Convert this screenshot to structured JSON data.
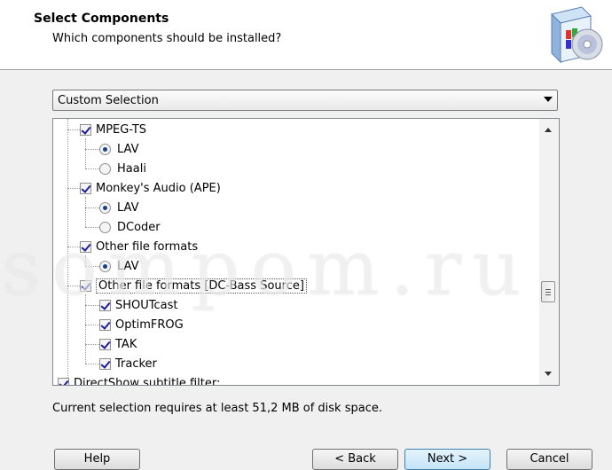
{
  "header": {
    "title": "Select Components",
    "subtitle": "Which components should be installed?"
  },
  "combo": {
    "value": "Custom Selection"
  },
  "tree": {
    "items": [
      {
        "label": "MPEG-TS",
        "type": "checkbox",
        "checked": true
      },
      {
        "label": "LAV",
        "type": "radio",
        "checked": true
      },
      {
        "label": "Haali",
        "type": "radio",
        "checked": false
      },
      {
        "label": "Monkey's Audio (APE)",
        "type": "checkbox",
        "checked": true
      },
      {
        "label": "LAV",
        "type": "radio",
        "checked": true
      },
      {
        "label": "DCoder",
        "type": "radio",
        "checked": false
      },
      {
        "label": "Other file formats",
        "type": "checkbox",
        "checked": true
      },
      {
        "label": "LAV",
        "type": "radio",
        "checked": true
      },
      {
        "label": "Other file formats [DC-Bass Source]",
        "type": "checkbox",
        "checked": true
      },
      {
        "label": "SHOUTcast",
        "type": "checkbox",
        "checked": true
      },
      {
        "label": "OptimFROG",
        "type": "checkbox",
        "checked": true
      },
      {
        "label": "TAK",
        "type": "checkbox",
        "checked": true
      },
      {
        "label": "Tracker",
        "type": "checkbox",
        "checked": true
      },
      {
        "label": "DirectShow subtitle filter:",
        "type": "checkbox",
        "checked": true
      }
    ]
  },
  "status_text": "Current selection requires at least 51,2 MB of disk space.",
  "buttons": {
    "help": "Help",
    "back": "< Back",
    "next": "Next >",
    "cancel": "Cancel"
  },
  "watermark": "sompom.ru"
}
